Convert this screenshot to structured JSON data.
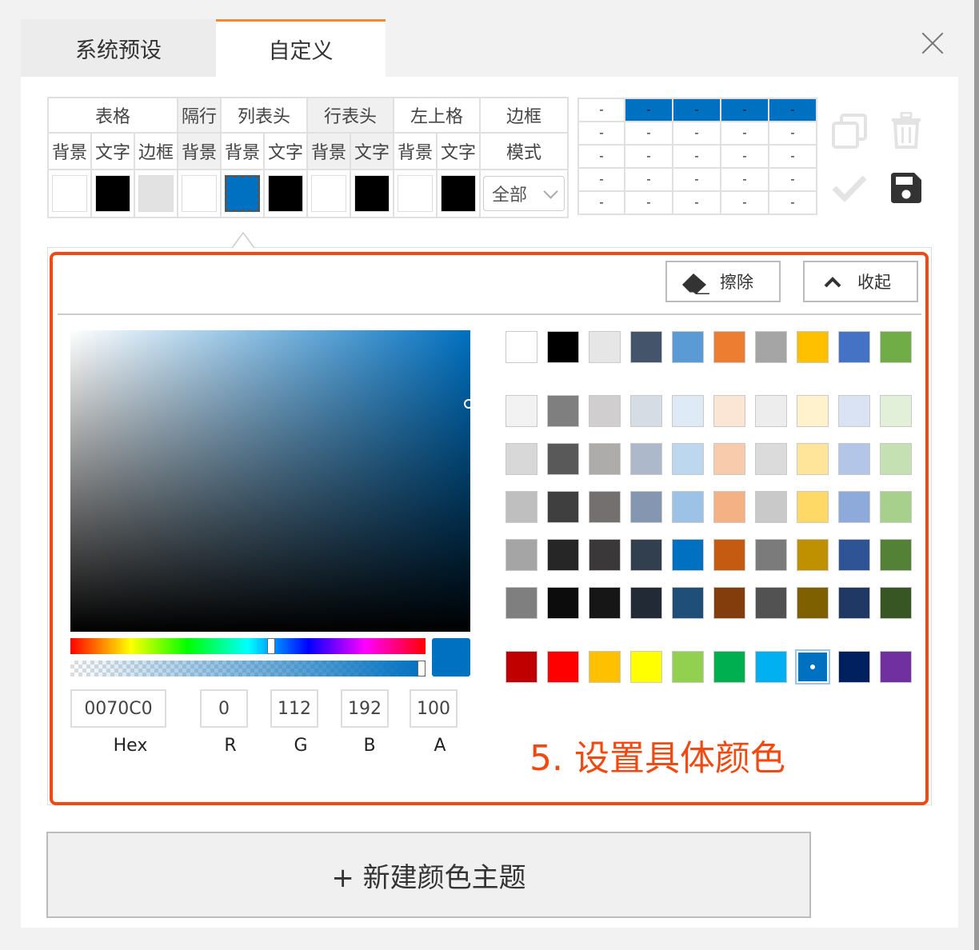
{
  "tabs": [
    {
      "label": "系统预设",
      "active": false
    },
    {
      "label": "自定义",
      "active": true
    }
  ],
  "config": {
    "headers": {
      "table": "表格",
      "alt_row": "隔行",
      "col_header": "列表头",
      "row_header": "行表头",
      "top_left": "左上格",
      "border": "边框"
    },
    "subheaders": [
      "背景",
      "文字",
      "边框",
      "背景",
      "背景",
      "文字",
      "背景",
      "文字",
      "背景",
      "文字"
    ],
    "border_sub": "模式",
    "swatches": [
      "#ffffff",
      "#000000",
      "#e2e2e2",
      "#ffffff",
      "#0070C0",
      "#000000",
      "#ffffff",
      "#000000",
      "#ffffff",
      "#000000"
    ],
    "mode_value": "全部"
  },
  "preview": {
    "cell": "-",
    "header_color": "#0070C0"
  },
  "actions": {
    "copy_icon": "copy-icon",
    "delete_icon": "trash-icon",
    "confirm_icon": "check-icon",
    "save_icon": "save-icon"
  },
  "picker": {
    "erase_label": "擦除",
    "collapse_label": "收起",
    "hex": "0070C0",
    "r": "0",
    "g": "112",
    "b": "192",
    "a": "100",
    "labels": {
      "hex": "Hex",
      "r": "R",
      "g": "G",
      "b": "B",
      "a": "A"
    },
    "current_color": "#0070C0",
    "palette": [
      [
        "#ffffff",
        "#000000",
        "#e7e6e6",
        "#44546a",
        "#5b9bd5",
        "#ed7d31",
        "#a5a5a5",
        "#ffc000",
        "#4472c4",
        "#70ad47"
      ],
      [
        "#f2f2f2",
        "#7f7f7f",
        "#d0cece",
        "#d6dce4",
        "#deebf6",
        "#fbe5d5",
        "#ededed",
        "#fff2cc",
        "#dae3f3",
        "#e2efd9"
      ],
      [
        "#d8d8d8",
        "#595959",
        "#aeabab",
        "#adb9ca",
        "#bdd7ee",
        "#f7cbac",
        "#dbdbdb",
        "#fee599",
        "#b4c6e7",
        "#c5e0b3"
      ],
      [
        "#bfbfbf",
        "#3f3f3f",
        "#757070",
        "#8496b0",
        "#9cc3e5",
        "#f4b183",
        "#c9c9c9",
        "#ffd965",
        "#8eaadb",
        "#a8d08d"
      ],
      [
        "#a5a5a5",
        "#262626",
        "#3a3838",
        "#323f4f",
        "#0070C0",
        "#c55a11",
        "#7b7b7b",
        "#bf9000",
        "#2f5496",
        "#538135"
      ],
      [
        "#7f7f7f",
        "#0c0c0c",
        "#171616",
        "#222a35",
        "#1f4e79",
        "#833c0b",
        "#525252",
        "#7f6000",
        "#1f3864",
        "#375623"
      ],
      [
        "#c00000",
        "#ff0000",
        "#ffc000",
        "#ffff00",
        "#92d050",
        "#00b050",
        "#00b0f0",
        "#0070C0",
        "#002060",
        "#7030a0"
      ]
    ],
    "selected_row": 6,
    "selected_col": 7
  },
  "annotation": "5. 设置具体颜色",
  "new_theme_label": "+ 新建颜色主题"
}
